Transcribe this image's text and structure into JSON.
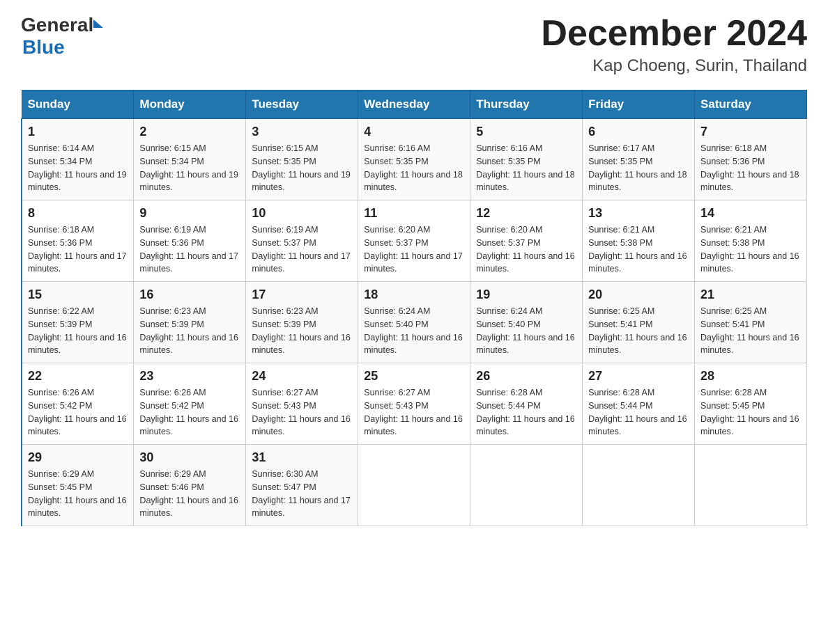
{
  "header": {
    "logo_general": "General",
    "logo_blue": "Blue",
    "month_year": "December 2024",
    "location": "Kap Choeng, Surin, Thailand"
  },
  "weekdays": [
    "Sunday",
    "Monday",
    "Tuesday",
    "Wednesday",
    "Thursday",
    "Friday",
    "Saturday"
  ],
  "weeks": [
    [
      {
        "day": "1",
        "sunrise": "6:14 AM",
        "sunset": "5:34 PM",
        "daylight": "11 hours and 19 minutes."
      },
      {
        "day": "2",
        "sunrise": "6:15 AM",
        "sunset": "5:34 PM",
        "daylight": "11 hours and 19 minutes."
      },
      {
        "day": "3",
        "sunrise": "6:15 AM",
        "sunset": "5:35 PM",
        "daylight": "11 hours and 19 minutes."
      },
      {
        "day": "4",
        "sunrise": "6:16 AM",
        "sunset": "5:35 PM",
        "daylight": "11 hours and 18 minutes."
      },
      {
        "day": "5",
        "sunrise": "6:16 AM",
        "sunset": "5:35 PM",
        "daylight": "11 hours and 18 minutes."
      },
      {
        "day": "6",
        "sunrise": "6:17 AM",
        "sunset": "5:35 PM",
        "daylight": "11 hours and 18 minutes."
      },
      {
        "day": "7",
        "sunrise": "6:18 AM",
        "sunset": "5:36 PM",
        "daylight": "11 hours and 18 minutes."
      }
    ],
    [
      {
        "day": "8",
        "sunrise": "6:18 AM",
        "sunset": "5:36 PM",
        "daylight": "11 hours and 17 minutes."
      },
      {
        "day": "9",
        "sunrise": "6:19 AM",
        "sunset": "5:36 PM",
        "daylight": "11 hours and 17 minutes."
      },
      {
        "day": "10",
        "sunrise": "6:19 AM",
        "sunset": "5:37 PM",
        "daylight": "11 hours and 17 minutes."
      },
      {
        "day": "11",
        "sunrise": "6:20 AM",
        "sunset": "5:37 PM",
        "daylight": "11 hours and 17 minutes."
      },
      {
        "day": "12",
        "sunrise": "6:20 AM",
        "sunset": "5:37 PM",
        "daylight": "11 hours and 16 minutes."
      },
      {
        "day": "13",
        "sunrise": "6:21 AM",
        "sunset": "5:38 PM",
        "daylight": "11 hours and 16 minutes."
      },
      {
        "day": "14",
        "sunrise": "6:21 AM",
        "sunset": "5:38 PM",
        "daylight": "11 hours and 16 minutes."
      }
    ],
    [
      {
        "day": "15",
        "sunrise": "6:22 AM",
        "sunset": "5:39 PM",
        "daylight": "11 hours and 16 minutes."
      },
      {
        "day": "16",
        "sunrise": "6:23 AM",
        "sunset": "5:39 PM",
        "daylight": "11 hours and 16 minutes."
      },
      {
        "day": "17",
        "sunrise": "6:23 AM",
        "sunset": "5:39 PM",
        "daylight": "11 hours and 16 minutes."
      },
      {
        "day": "18",
        "sunrise": "6:24 AM",
        "sunset": "5:40 PM",
        "daylight": "11 hours and 16 minutes."
      },
      {
        "day": "19",
        "sunrise": "6:24 AM",
        "sunset": "5:40 PM",
        "daylight": "11 hours and 16 minutes."
      },
      {
        "day": "20",
        "sunrise": "6:25 AM",
        "sunset": "5:41 PM",
        "daylight": "11 hours and 16 minutes."
      },
      {
        "day": "21",
        "sunrise": "6:25 AM",
        "sunset": "5:41 PM",
        "daylight": "11 hours and 16 minutes."
      }
    ],
    [
      {
        "day": "22",
        "sunrise": "6:26 AM",
        "sunset": "5:42 PM",
        "daylight": "11 hours and 16 minutes."
      },
      {
        "day": "23",
        "sunrise": "6:26 AM",
        "sunset": "5:42 PM",
        "daylight": "11 hours and 16 minutes."
      },
      {
        "day": "24",
        "sunrise": "6:27 AM",
        "sunset": "5:43 PM",
        "daylight": "11 hours and 16 minutes."
      },
      {
        "day": "25",
        "sunrise": "6:27 AM",
        "sunset": "5:43 PM",
        "daylight": "11 hours and 16 minutes."
      },
      {
        "day": "26",
        "sunrise": "6:28 AM",
        "sunset": "5:44 PM",
        "daylight": "11 hours and 16 minutes."
      },
      {
        "day": "27",
        "sunrise": "6:28 AM",
        "sunset": "5:44 PM",
        "daylight": "11 hours and 16 minutes."
      },
      {
        "day": "28",
        "sunrise": "6:28 AM",
        "sunset": "5:45 PM",
        "daylight": "11 hours and 16 minutes."
      }
    ],
    [
      {
        "day": "29",
        "sunrise": "6:29 AM",
        "sunset": "5:45 PM",
        "daylight": "11 hours and 16 minutes."
      },
      {
        "day": "30",
        "sunrise": "6:29 AM",
        "sunset": "5:46 PM",
        "daylight": "11 hours and 16 minutes."
      },
      {
        "day": "31",
        "sunrise": "6:30 AM",
        "sunset": "5:47 PM",
        "daylight": "11 hours and 17 minutes."
      },
      null,
      null,
      null,
      null
    ]
  ]
}
